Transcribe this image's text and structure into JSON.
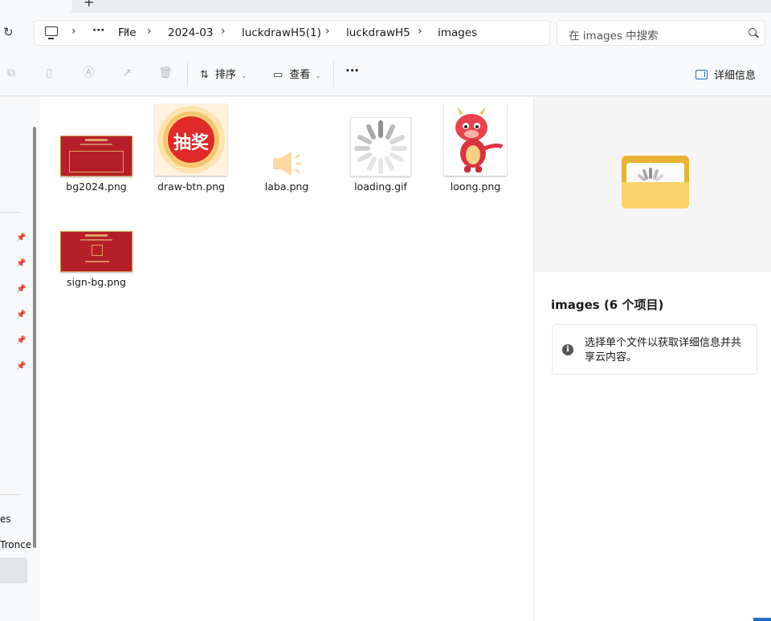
{
  "tabs": {
    "close_glyph": "×",
    "new_tab_glyph": "+"
  },
  "address": {
    "refresh_glyph": "↻",
    "more_glyph": "···",
    "segments": [
      "File",
      "2024-03",
      "luckdrawH5(1)",
      "luckdrawH5",
      "images"
    ],
    "separator": "›"
  },
  "search": {
    "placeholder": "在 images 中搜索"
  },
  "toolbar": {
    "sort_label": "排序",
    "view_label": "查看",
    "more_label": "···",
    "details_label": "详细信息"
  },
  "nav": {
    "pin_count": 6,
    "partial_items": [
      "es",
      "Tronce"
    ]
  },
  "files": [
    {
      "name": "bg2024.png",
      "kind": "red-card"
    },
    {
      "name": "draw-btn.png",
      "kind": "draw-button",
      "overlay_text": "抽奖"
    },
    {
      "name": "laba.png",
      "kind": "speaker"
    },
    {
      "name": "loading.gif",
      "kind": "spinner"
    },
    {
      "name": "loong.png",
      "kind": "dragon"
    },
    {
      "name": "sign-bg.png",
      "kind": "red-card-sign"
    }
  ],
  "details": {
    "title": "images (6 个项目)",
    "info_text": "选择单个文件以获取详细信息并共享云内容。",
    "info_glyph": "i"
  },
  "colors": {
    "accent": "#1f6fbf",
    "folder": "#e9b233",
    "red": "#b51f2a"
  }
}
